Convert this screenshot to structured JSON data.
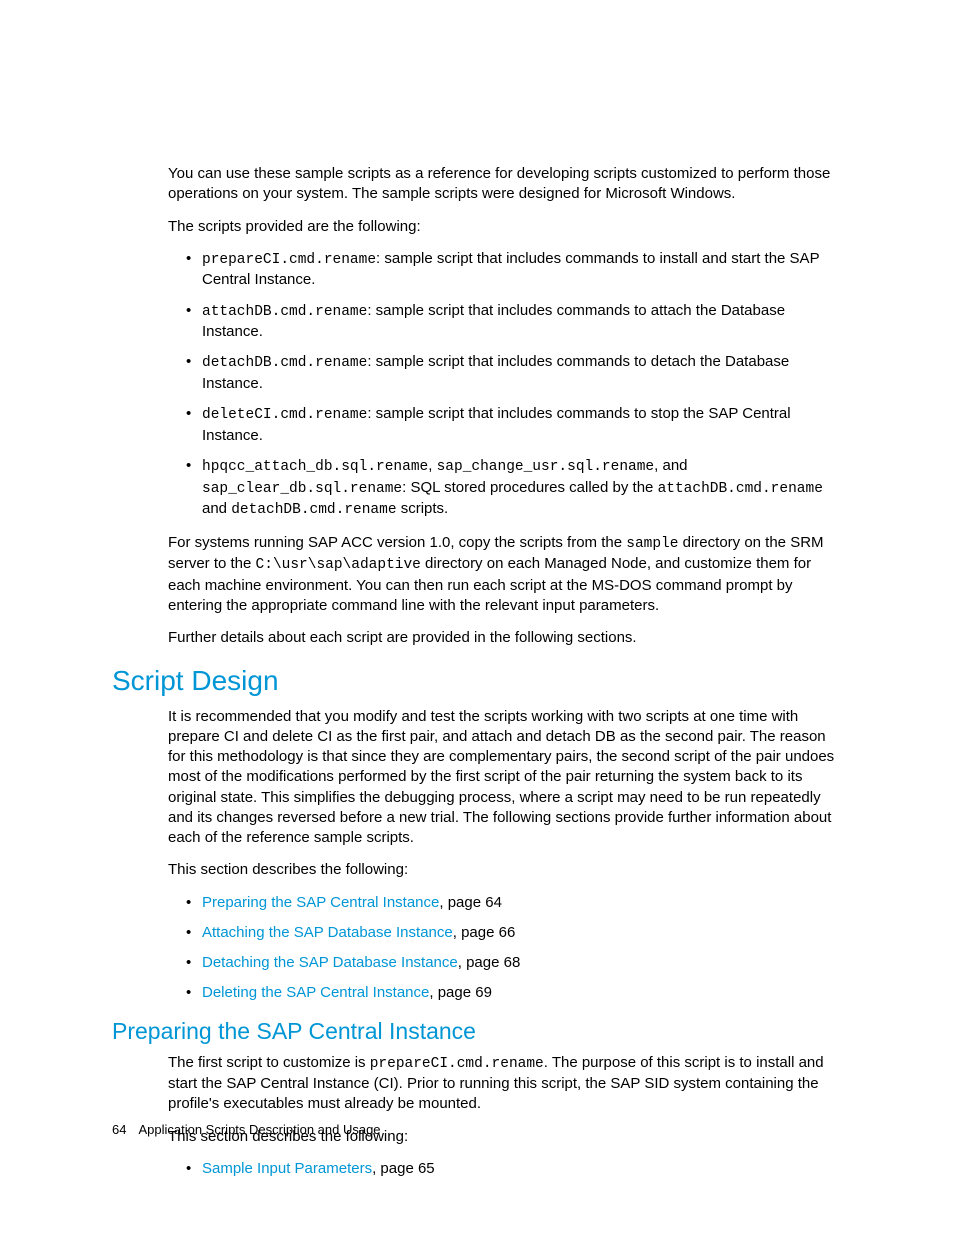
{
  "intro1": "You can use these sample scripts as a reference for developing scripts customized to perform those operations on your system. The sample scripts were designed for Microsoft Windows.",
  "intro2": "The scripts provided are the following:",
  "scripts": [
    {
      "code": "prepareCI.cmd.rename",
      "desc": ": sample script that includes commands to install and start the SAP Central Instance."
    },
    {
      "code": "attachDB.cmd.rename",
      "desc": ": sample script that includes commands to attach the Database Instance."
    },
    {
      "code": "detachDB.cmd.rename",
      "desc": ": sample script that includes commands to detach the Database Instance."
    },
    {
      "code": "deleteCI.cmd.rename",
      "desc": ": sample script that includes commands to stop the SAP Central Instance."
    }
  ],
  "sql": {
    "c1": "hpqcc_attach_db.sql.rename",
    "c2": "sap_change_usr.sql.rename",
    "c3": "sap_clear_db.sql.rename",
    "c4": "attachDB.cmd.rename",
    "c5": "detachDB.cmd.rename",
    "t1": ", ",
    "t2": ", and ",
    "t3": ": SQL stored procedures called by the ",
    "t4": " and ",
    "t5": " scripts."
  },
  "para_acc": {
    "p1": "For systems running SAP ACC version 1.0, copy the scripts from the ",
    "c1": "sample",
    "p2": " directory on the SRM server to the ",
    "c2": "C:\\usr\\sap\\adaptive",
    "p3": " directory on each Managed Node, and customize them for each machine environment. You can then run each script at the MS-DOS command prompt by entering the appropriate command line with the relevant input parameters."
  },
  "further": "Further details about each script are provided in the following sections.",
  "h1": "Script Design",
  "sd_para": "It is recommended that you modify and test the scripts working with two scripts at one time with prepare CI and delete CI as the first pair, and attach and detach DB as the second pair. The reason for this methodology is that since they are complementary pairs, the second script of the pair undoes most of the modifications performed by the first script of the pair returning the system back to its original state. This simplifies the debugging process, where a script may need to be run repeatedly and its changes reversed before a new trial. The following sections provide further information about each of the reference sample scripts.",
  "sd_intro": "This section describes the following:",
  "sd_links": [
    {
      "text": "Preparing the SAP Central Instance",
      "page": ", page 64"
    },
    {
      "text": "Attaching the SAP Database Instance",
      "page": ", page 66"
    },
    {
      "text": "Detaching the SAP Database Instance",
      "page": ", page 68"
    },
    {
      "text": "Deleting the SAP Central Instance",
      "page": ", page 69"
    }
  ],
  "h2": "Preparing the SAP Central Instance",
  "prep": {
    "p1": "The first script to customize is ",
    "c1": "prepareCI.cmd.rename",
    "p2": ". The purpose of this script is to install and start the SAP Central Instance (CI). Prior to running this script, the SAP SID system containing the profile's executables must already be mounted."
  },
  "prep_intro": "This section describes the following:",
  "prep_links": [
    {
      "text": "Sample Input Parameters",
      "page": ", page 65"
    }
  ],
  "footer": {
    "num": "64",
    "title": "Application Scripts Description and Usage"
  }
}
